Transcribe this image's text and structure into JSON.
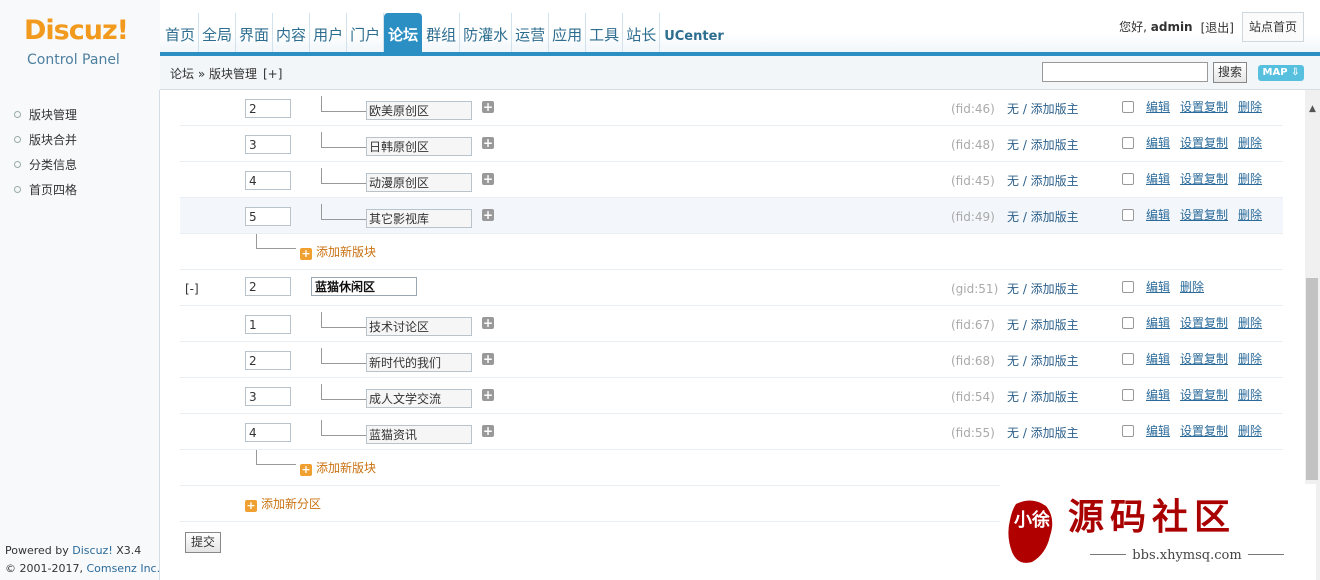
{
  "app": {
    "logo": "Discuz!",
    "logo_sub": "Control Panel"
  },
  "nav": {
    "items": [
      "首页",
      "全局",
      "界面",
      "内容",
      "用户",
      "门户",
      "论坛",
      "群组",
      "防灌水",
      "运营",
      "应用",
      "工具",
      "站长",
      "UCenter"
    ],
    "active": "论坛"
  },
  "user": {
    "greeting_prefix": "您好, ",
    "name": "admin",
    "logout": "[退出]",
    "site_home": "站点首页"
  },
  "breadcrumb": {
    "text": "论坛 » 版块管理",
    "toggle": "[+]"
  },
  "search": {
    "value": "",
    "button": "搜索",
    "map": "MAP"
  },
  "sidebar": {
    "items": [
      "版块管理",
      "版块合并",
      "分类信息",
      "首页四格"
    ],
    "powered_prefix": "Powered by ",
    "powered_brand": "Discuz!",
    "powered_version": " X3.4",
    "copyright_prefix": "© 2001-2017, ",
    "copyright_brand": "Comsenz Inc."
  },
  "forum_list": {
    "group1_forums": [
      {
        "order": "2",
        "name": "欧美原创区",
        "fid": "(fid:46)",
        "moderator": "无 / 添加版主"
      },
      {
        "order": "3",
        "name": "日韩原创区",
        "fid": "(fid:48)",
        "moderator": "无 / 添加版主"
      },
      {
        "order": "4",
        "name": "动漫原创区",
        "fid": "(fid:45)",
        "moderator": "无 / 添加版主"
      },
      {
        "order": "5",
        "name": "其它影视库",
        "fid": "(fid:49)",
        "moderator": "无 / 添加版主"
      }
    ],
    "add_forum": "添加新版块",
    "group2": {
      "toggle": "[-]",
      "order": "2",
      "name": "蓝猫休闲区",
      "gid": "(gid:51)",
      "moderator": "无 / 添加版主"
    },
    "group2_forums": [
      {
        "order": "1",
        "name": "技术讨论区",
        "fid": "(fid:67)",
        "moderator": "无 / 添加版主"
      },
      {
        "order": "2",
        "name": "新时代的我们",
        "fid": "(fid:68)",
        "moderator": "无 / 添加版主"
      },
      {
        "order": "3",
        "name": "成人文学交流",
        "fid": "(fid:54)",
        "moderator": "无 / 添加版主"
      },
      {
        "order": "4",
        "name": "蓝猫资讯",
        "fid": "(fid:55)",
        "moderator": "无 / 添加版主"
      }
    ],
    "add_group": "添加新分区",
    "actions": {
      "edit": "编辑",
      "copy": "设置复制",
      "delete": "删除"
    },
    "submit": "提交"
  },
  "watermark": {
    "seal": "小徐",
    "title": "源码社区",
    "url": "bbs.xhymsq.com"
  },
  "colors": {
    "accent": "#2b8fc3",
    "logo": "#f29a1e",
    "link": "#2b6b9a",
    "add_link": "#c97212",
    "watermark": "#a90000"
  }
}
